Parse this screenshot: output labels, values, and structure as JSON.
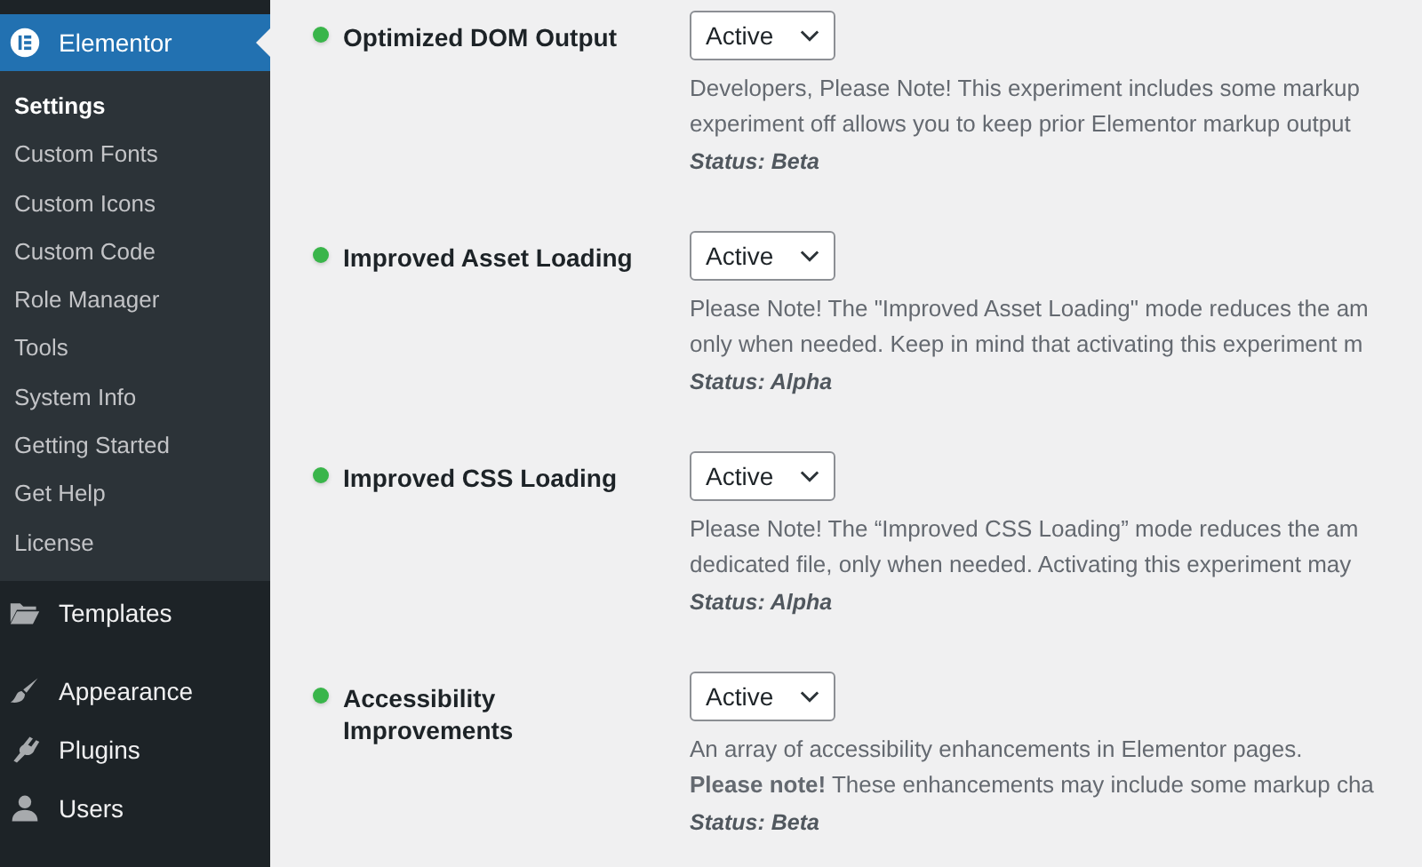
{
  "sidebar": {
    "current": {
      "label": "Elementor",
      "selected": true
    },
    "submenu": [
      {
        "label": "Settings",
        "selected": true
      },
      {
        "label": "Custom Fonts",
        "selected": false
      },
      {
        "label": "Custom Icons",
        "selected": false
      },
      {
        "label": "Custom Code",
        "selected": false
      },
      {
        "label": "Role Manager",
        "selected": false
      },
      {
        "label": "Tools",
        "selected": false
      },
      {
        "label": "System Info",
        "selected": false
      },
      {
        "label": "Getting Started",
        "selected": false
      },
      {
        "label": "Get Help",
        "selected": false
      },
      {
        "label": "License",
        "selected": false
      }
    ],
    "items": [
      {
        "label": "Templates"
      },
      {
        "label": "Appearance"
      },
      {
        "label": "Plugins"
      },
      {
        "label": "Users"
      }
    ]
  },
  "experiments": [
    {
      "title": "Optimized DOM Output",
      "value": "Active",
      "description": [
        "Developers, Please Note! This experiment includes some markup",
        "experiment off allows you to keep prior Elementor markup output"
      ],
      "status": "Status: Beta"
    },
    {
      "title": "Improved Asset Loading",
      "value": "Active",
      "description": [
        "Please Note! The \"Improved Asset Loading\" mode reduces the am",
        "only when needed. Keep in mind that activating this experiment m"
      ],
      "status": "Status: Alpha"
    },
    {
      "title": "Improved CSS Loading",
      "value": "Active",
      "description": [
        "Please Note! The “Improved CSS Loading” mode reduces the am",
        "dedicated file, only when needed. Activating this experiment may"
      ],
      "status": "Status: Alpha"
    },
    {
      "title": "Accessibility Improvements",
      "value": "Active",
      "description": [
        "An array of accessibility enhancements in Elementor pages.",
        "**Please note!** These enhancements may include some markup cha"
      ],
      "status": "Status: Beta"
    }
  ]
}
